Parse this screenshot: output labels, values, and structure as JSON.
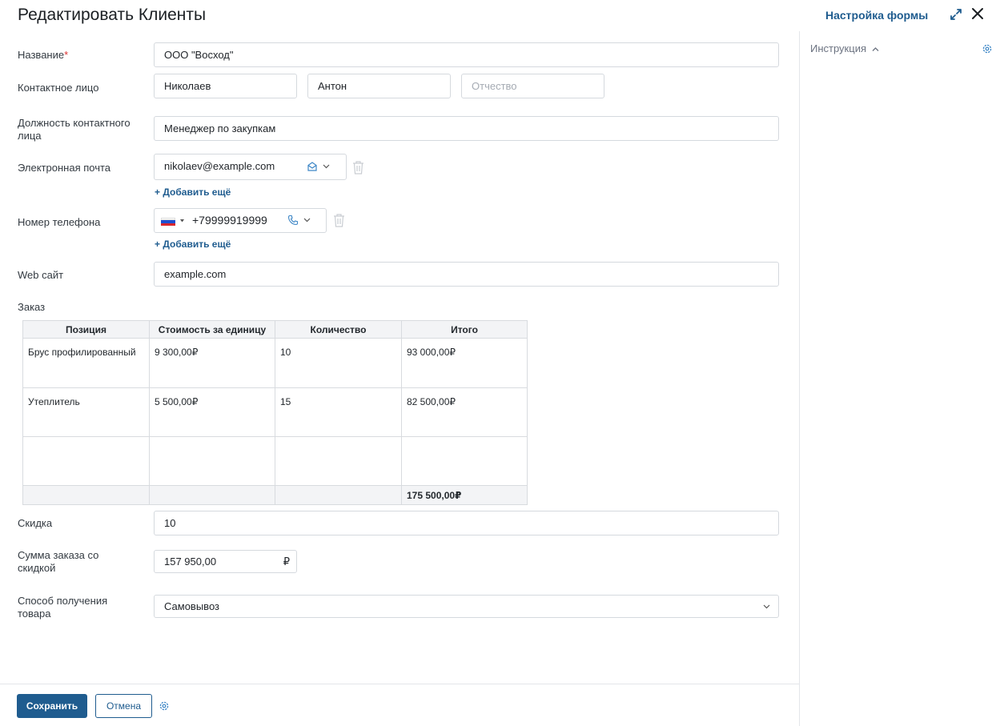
{
  "header": {
    "title": "Редактировать Клиенты",
    "form_settings": "Настройка формы"
  },
  "sidebar": {
    "title": "Инструкция"
  },
  "fields": {
    "name": {
      "label": "Название",
      "required_mark": "*",
      "value": "ООО \"Восход\""
    },
    "contact": {
      "label": "Контактное лицо",
      "last_name": "Николаев",
      "first_name": "Антон",
      "middle_placeholder": "Отчество"
    },
    "position": {
      "label_line1": "Должность контактного",
      "label_line2": "лица",
      "value": "Менеджер по закупкам"
    },
    "email": {
      "label": "Электронная почта",
      "value": "nikolaev@example.com",
      "add_more": "+ Добавить ещё"
    },
    "phone": {
      "label": "Номер телефона",
      "value": "+79999919999",
      "add_more": "+ Добавить ещё"
    },
    "website": {
      "label": "Web сайт",
      "value": "example.com"
    },
    "order": {
      "label": "Заказ",
      "columns": [
        "Позиция",
        "Стоимость за единицу",
        "Количество",
        "Итого"
      ],
      "rows": [
        [
          "Брус профилированный",
          "9 300,00₽",
          "10",
          "93 000,00₽"
        ],
        [
          "Утеплитель",
          "5 500,00₽",
          "15",
          "82 500,00₽"
        ],
        [
          "",
          "",
          "",
          ""
        ]
      ],
      "total": "175 500,00₽"
    },
    "discount": {
      "label": "Скидка",
      "value": "10"
    },
    "sum_discount": {
      "label_line1": "Сумма заказа со",
      "label_line2": "скидкой",
      "value": "157 950,00",
      "currency": "₽"
    },
    "delivery": {
      "label_line1": "Способ получения",
      "label_line2": "товара",
      "value": "Самовывоз"
    }
  },
  "footer": {
    "save": "Сохранить",
    "cancel": "Отмена"
  },
  "colors": {
    "accent": "#1f5c8f",
    "border": "#d5d9de",
    "required": "#dd3333"
  }
}
